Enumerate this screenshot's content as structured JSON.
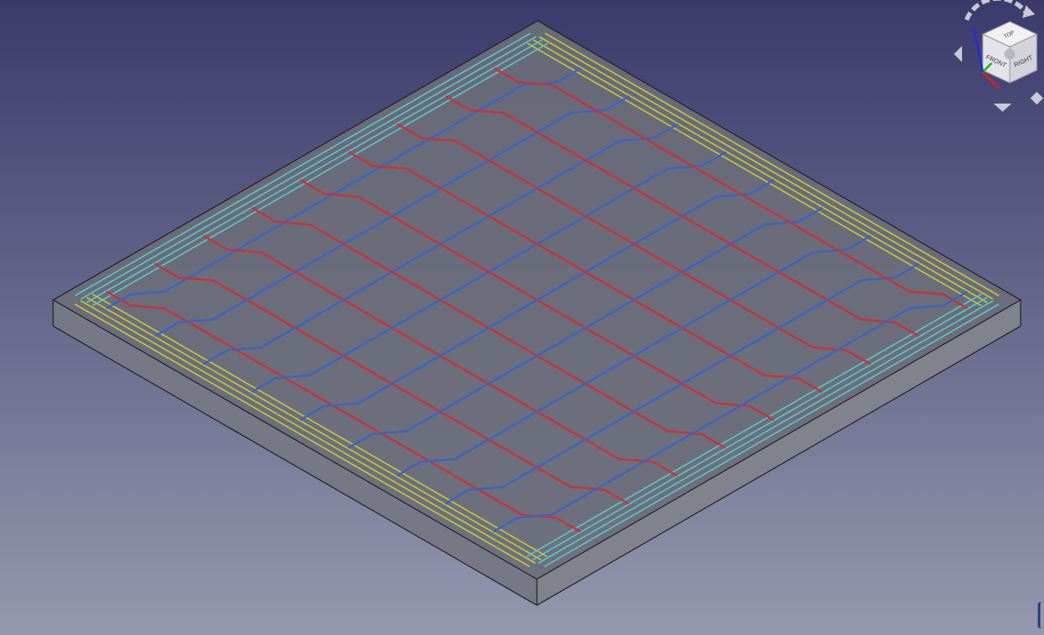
{
  "viewport": {
    "background_top": "#3b3a6c",
    "background_bottom": "#9598ae"
  },
  "slab": {
    "fill": "#6b6e7a",
    "edge": "#1e1e22"
  },
  "rebar_colors": {
    "top_x": "#c8323a",
    "top_y": "#3b63c4",
    "bottom_x": "#c8c83a",
    "bottom_y": "#5ac8c8"
  },
  "navigation_cube": {
    "faces": {
      "top": "TOP",
      "front": "FRONT",
      "right": "RIGHT"
    },
    "arrow_color": "#c9c9d2",
    "axis_colors": {
      "x": "#d82020",
      "y": "#20b020",
      "z": "#2030d0"
    }
  }
}
